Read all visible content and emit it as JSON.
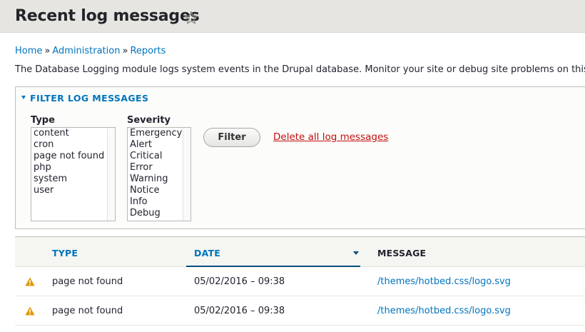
{
  "header": {
    "title": "Recent log messages",
    "favorite_icon": "star-outline-icon"
  },
  "breadcrumb": {
    "items": [
      "Home",
      "Administration",
      "Reports"
    ],
    "separator": "»"
  },
  "description": "The Database Logging module logs system events in the Drupal database. Monitor your site or debug site problems on this pa",
  "filter": {
    "summary": "FILTER LOG MESSAGES",
    "type_label": "Type",
    "type_options": [
      "content",
      "cron",
      "page not found",
      "php",
      "system",
      "user"
    ],
    "severity_label": "Severity",
    "severity_options": [
      "Emergency",
      "Alert",
      "Critical",
      "Error",
      "Warning",
      "Notice",
      "Info",
      "Debug"
    ],
    "filter_button": "Filter",
    "delete_link": "Delete all log messages"
  },
  "table": {
    "columns": {
      "type": "TYPE",
      "date": "DATE",
      "message": "MESSAGE"
    },
    "sorted_column": "date",
    "rows": [
      {
        "icon": "warning-icon",
        "type": "page not found",
        "date": "05/02/2016 – 09:38",
        "message": "/themes/hotbed.css/logo.svg"
      },
      {
        "icon": "warning-icon",
        "type": "page not found",
        "date": "05/02/2016 – 09:38",
        "message": "/themes/hotbed.css/logo.svg"
      }
    ]
  },
  "colors": {
    "link": "#0074bd",
    "delete": "#c30f0f",
    "warning": "#e09600",
    "header_bg": "#e6e5e1"
  }
}
